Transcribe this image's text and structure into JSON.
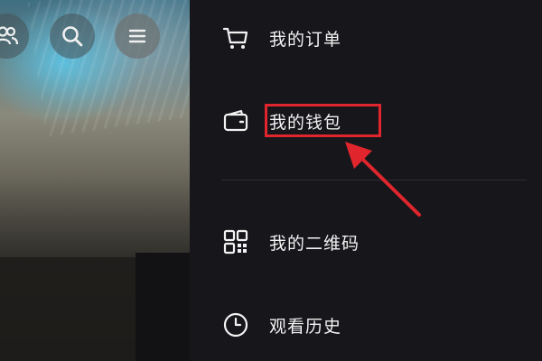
{
  "top_bar": {
    "icons": [
      "people-icon",
      "search-icon",
      "menu-icon"
    ]
  },
  "drawer": {
    "items": [
      {
        "label": "我的订单",
        "icon": "shopping-cart-icon"
      },
      {
        "label": "我的钱包",
        "icon": "wallet-icon"
      },
      {
        "label": "我的二维码",
        "icon": "qr-code-icon"
      },
      {
        "label": "观看历史",
        "icon": "clock-icon"
      }
    ]
  },
  "annotation": {
    "highlight_color": "#e0262c",
    "highlighted_item": "我的钱包"
  },
  "colors": {
    "drawer_background": "#16161b",
    "text": "#f2f2f2",
    "divider": "#2c2c33"
  }
}
